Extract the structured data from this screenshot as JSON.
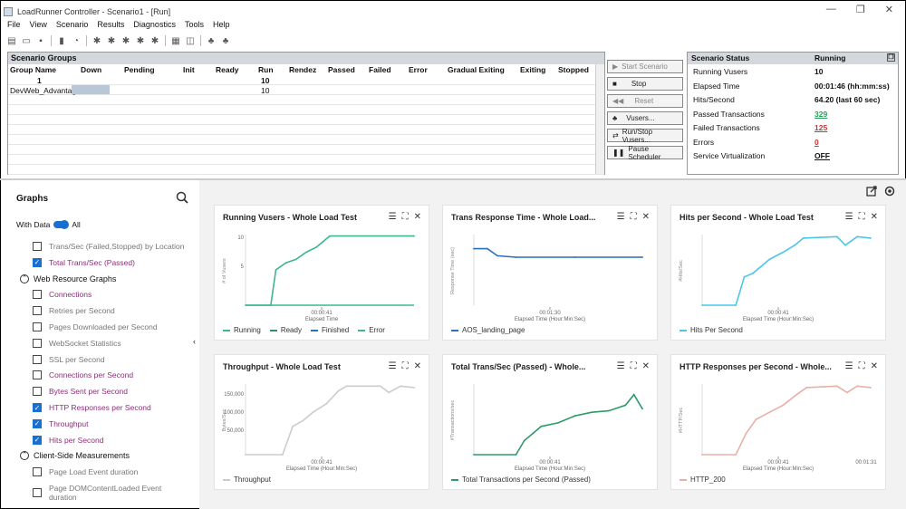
{
  "window": {
    "title": "LoadRunner Controller - Scenario1 - [Run]",
    "min": "—",
    "restore": "❐",
    "close": "✕"
  },
  "menu": [
    "File",
    "View",
    "Scenario",
    "Results",
    "Diagnostics",
    "Tools",
    "Help"
  ],
  "scenario_groups": {
    "title": "Scenario Groups",
    "columns": [
      "Group Name",
      "Down",
      "Pending",
      "Init",
      "Ready",
      "Run",
      "Rendez",
      "Passed",
      "Failed",
      "Error",
      "Gradual Exiting",
      "Exiting",
      "Stopped"
    ],
    "total_row": {
      "group": "1",
      "run": "10"
    },
    "rows": [
      {
        "group": "DevWeb_Advantag",
        "run": "10"
      }
    ]
  },
  "controls": {
    "start": "Start Scenario",
    "stop": "Stop",
    "reset": "Reset",
    "vusers": "Vusers...",
    "runstop": "Run/Stop Vusers...",
    "pause": "Pause Scheduler"
  },
  "status": {
    "title": "Scenario Status",
    "state": "Running",
    "rows": [
      {
        "label": "Running Vusers",
        "value": "10"
      },
      {
        "label": "Elapsed Time",
        "value": "00:01:46 (hh:mm:ss)"
      },
      {
        "label": "Hits/Second",
        "value": "64.20 (last 60 sec)"
      },
      {
        "label": "Passed Transactions",
        "value": "329"
      },
      {
        "label": "Failed Transactions",
        "value": "125"
      },
      {
        "label": "Errors",
        "value": "0"
      },
      {
        "label": "Service Virtualization",
        "value": "OFF"
      }
    ]
  },
  "graphs_panel": {
    "title": "Graphs",
    "with_data": "With Data",
    "all": "All",
    "items": [
      {
        "label": "Trans/Sec (Failed,Stopped) by Location",
        "checked": false,
        "purple": false
      },
      {
        "label": "Total Trans/Sec (Passed)",
        "checked": true,
        "purple": true
      }
    ],
    "section1": "Web Resource Graphs",
    "web_items": [
      {
        "label": "Connections",
        "checked": false,
        "purple": true
      },
      {
        "label": "Retries per Second",
        "checked": false,
        "purple": false
      },
      {
        "label": "Pages Downloaded per Second",
        "checked": false,
        "purple": false
      },
      {
        "label": "WebSocket Statistics",
        "checked": false,
        "purple": false
      },
      {
        "label": "SSL per Second",
        "checked": false,
        "purple": false
      },
      {
        "label": "Connections per Second",
        "checked": false,
        "purple": true
      },
      {
        "label": "Bytes Sent per Second",
        "checked": false,
        "purple": true
      },
      {
        "label": "HTTP Responses per Second",
        "checked": true,
        "purple": true
      },
      {
        "label": "Throughput",
        "checked": true,
        "purple": true
      },
      {
        "label": "Hits per Second",
        "checked": true,
        "purple": true
      }
    ],
    "section2": "Client-Side Measurements",
    "client_items": [
      {
        "label": "Page Load Event duration",
        "checked": false,
        "purple": false
      },
      {
        "label": "Page DOMContentLoaded Event duration",
        "checked": false,
        "purple": false
      }
    ]
  },
  "cards": [
    {
      "title": "Running Vusers - Whole Load Test",
      "ylabel": "# of Vusers",
      "xtick": "00:00:41",
      "xlabel": "Elapsed Time",
      "yticks": [
        "10",
        "5"
      ],
      "legend": [
        {
          "name": "Running",
          "color": "#3cb88a"
        },
        {
          "name": "Ready",
          "color": "#2e8f6a"
        },
        {
          "name": "Finished",
          "color": "#2a6fba"
        },
        {
          "name": "Error",
          "color": "#3cb88a"
        }
      ]
    },
    {
      "title": "Trans Response Time - Whole Load...",
      "ylabel": "Response Time (sec)",
      "xtick": "00:01:30",
      "xlabel": "Elapsed Time (Hour:Min:Sec)",
      "yticks": [],
      "legend": [
        {
          "name": "AOS_landing_page",
          "color": "#2a6fba"
        }
      ]
    },
    {
      "title": "Hits per Second - Whole Load Test",
      "ylabel": "#Hits/Sec",
      "xtick": "00:00:41",
      "xlabel": "Elapsed Time (Hour:Min:Sec)",
      "yticks": [],
      "legend": [
        {
          "name": "Hits Per Second",
          "color": "#4cc6e6"
        }
      ]
    },
    {
      "title": "Throughput - Whole Load Test",
      "ylabel": "Bytes/Sec",
      "xtick": "00:00:41",
      "xlabel": "Elapsed Time (Hour:Min:Sec)",
      "yticks": [
        "150,000",
        "100,000",
        "50,000"
      ],
      "legend": [
        {
          "name": "Throughput",
          "color": "#cccccc"
        }
      ]
    },
    {
      "title": "Total Trans/Sec (Passed) - Whole...",
      "ylabel": "#Transactions/sec",
      "xtick": "00:00:41",
      "xlabel": "Elapsed Time (Hour:Min:Sec)",
      "yticks": [],
      "legend": [
        {
          "name": "Total Transactions per Second (Passed)",
          "color": "#2e9a6a"
        }
      ]
    },
    {
      "title": "HTTP Responses per Second - Whole...",
      "ylabel": "#HTTP/Sec",
      "xtick": "00:00:41",
      "xtick2": "00:01:31",
      "xlabel": "Elapsed Time (Hour:Min:Sec)",
      "yticks": [],
      "legend": [
        {
          "name": "HTTP_200",
          "color": "#e8b0a8"
        }
      ]
    }
  ]
}
